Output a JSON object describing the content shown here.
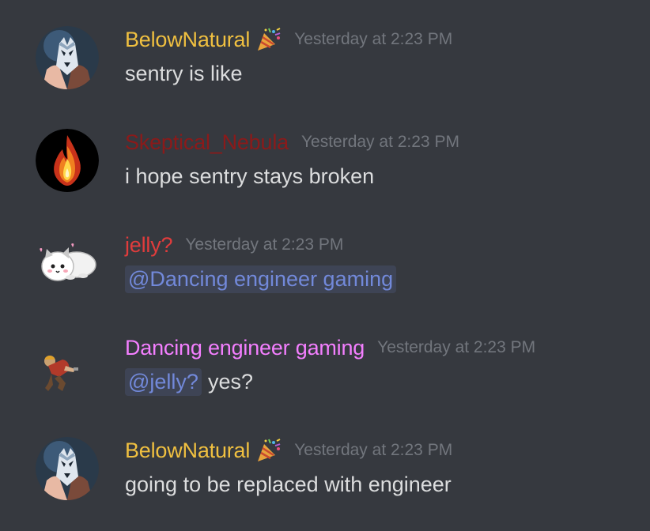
{
  "colors": {
    "background": "#36393f",
    "text": "#dcddde",
    "timestamp": "#72767d",
    "mention": "#7289da"
  },
  "messages": [
    {
      "username": "BelowNatural",
      "username_color": "#f0c040",
      "badge_icon": "party-popper-icon",
      "avatar": "wolf-avatar",
      "timestamp": "Yesterday at 2:23 PM",
      "text": "sentry is like"
    },
    {
      "username": "Skeptical_Nebula",
      "username_color": "#8b1a1a",
      "avatar": "flame-avatar",
      "timestamp": "Yesterday at 2:23 PM",
      "text": "i hope sentry stays broken"
    },
    {
      "username": "jelly?",
      "username_color": "#e03c3c",
      "avatar": "cat-avatar",
      "timestamp": "Yesterday at 2:23 PM",
      "mention": "@Dancing engineer gaming",
      "text": ""
    },
    {
      "username": "Dancing engineer gaming",
      "username_color": "#f47fff",
      "avatar": "engineer-avatar",
      "timestamp": "Yesterday at 2:23 PM",
      "mention": "@jelly?",
      "text": "yes?"
    },
    {
      "username": "BelowNatural",
      "username_color": "#f0c040",
      "badge_icon": "party-popper-icon",
      "avatar": "wolf-avatar",
      "timestamp": "Yesterday at 2:23 PM",
      "text": "going to be replaced with engineer"
    }
  ]
}
